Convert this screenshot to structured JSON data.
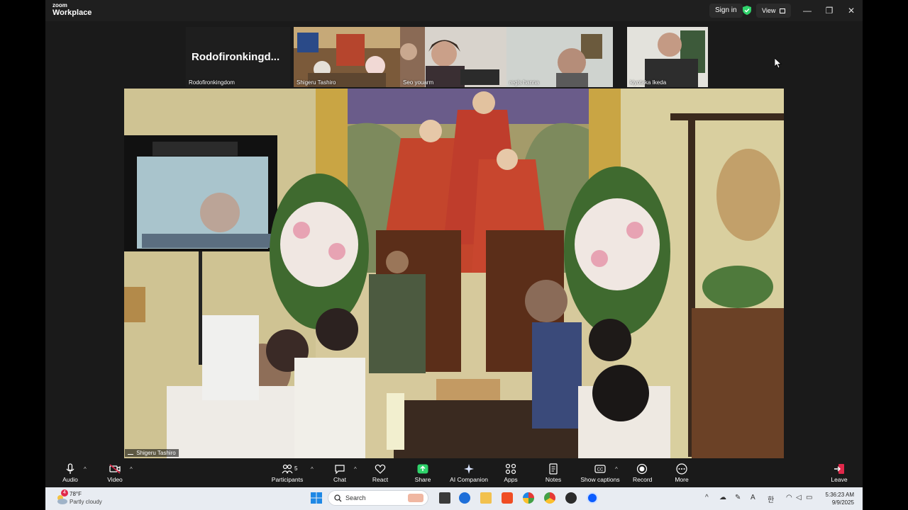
{
  "app": {
    "brand_small": "zoom",
    "brand_name": "Workplace"
  },
  "titlebar": {
    "sign_in": "Sign in",
    "view": "View"
  },
  "gallery": {
    "presenter_big": "Rodofironkingd...",
    "tiles": [
      {
        "name": "Rodofironkingdom"
      },
      {
        "name": "Shigeru Tashiro"
      },
      {
        "name": "Seo youarm"
      },
      {
        "name": "regis hanna"
      },
      {
        "name": "kiyotaka  Ikeda"
      }
    ]
  },
  "main": {
    "speaker_label": "Shigeru Tashiro"
  },
  "toolbar": {
    "audio": "Audio",
    "video": "Video",
    "participants": "Participants",
    "participants_count": "5",
    "chat": "Chat",
    "react": "React",
    "share": "Share",
    "ai_companion": "AI Companion",
    "apps": "Apps",
    "notes": "Notes",
    "show_captions": "Show captions",
    "record": "Record",
    "more": "More",
    "leave": "Leave"
  },
  "taskbar": {
    "weather_badge": "4",
    "temperature": "78°F",
    "condition": "Partly cloudy",
    "search_placeholder": "Search",
    "time": "5:36:23 AM",
    "date": "9/9/2025"
  },
  "colors": {
    "active_tile": "#2fd36b",
    "share": "#2fd36b",
    "leave": "#e0284a"
  }
}
